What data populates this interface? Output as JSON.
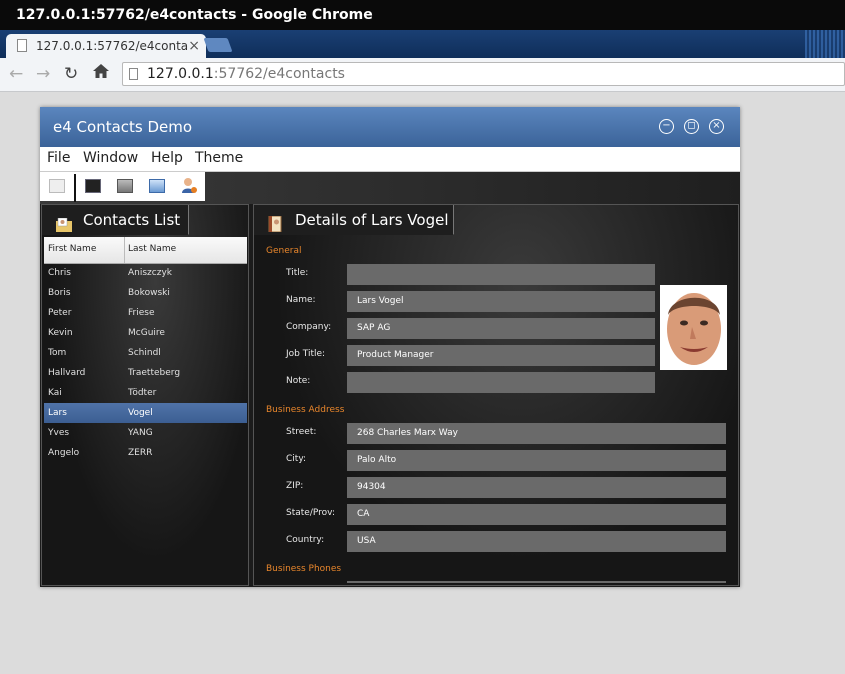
{
  "chrome": {
    "window_title": "127.0.0.1:57762/e4contacts - Google Chrome",
    "tab_title": "127.0.0.1:57762/e4conta",
    "tab_close": "×",
    "url_host": "127.0.0.1",
    "url_rest": ":57762/e4contacts"
  },
  "app": {
    "title": "e4 Contacts Demo",
    "window_buttons": {
      "minimize": "−",
      "maximize": "◻",
      "close": "×"
    },
    "menu": [
      "File",
      "Window",
      "Help",
      "Theme"
    ],
    "toolbar_icons": [
      "save-icon",
      "dark-theme-icon",
      "gray-theme-icon",
      "blue-theme-icon",
      "user-icon"
    ]
  },
  "contacts_panel": {
    "tab_label": "Contacts List",
    "columns": [
      "First Name",
      "Last Name"
    ],
    "rows": [
      {
        "first": "Chris",
        "last": "Aniszczyk"
      },
      {
        "first": "Boris",
        "last": "Bokowski"
      },
      {
        "first": "Peter",
        "last": "Friese"
      },
      {
        "first": "Kevin",
        "last": "McGuire"
      },
      {
        "first": "Tom",
        "last": "Schindl"
      },
      {
        "first": "Hallvard",
        "last": "Traetteberg"
      },
      {
        "first": "Kai",
        "last": "Tödter"
      },
      {
        "first": "Lars",
        "last": "Vogel"
      },
      {
        "first": "Yves",
        "last": "YANG"
      },
      {
        "first": "Angelo",
        "last": "ZERR"
      }
    ],
    "selected": "Lars"
  },
  "details_panel": {
    "tab_label": "Details of Lars Vogel",
    "general": {
      "title": "General",
      "fields": [
        {
          "label": "Title:",
          "value": ""
        },
        {
          "label": "Name:",
          "value": "Lars Vogel"
        },
        {
          "label": "Company:",
          "value": "SAP AG"
        },
        {
          "label": "Job Title:",
          "value": "Product Manager"
        },
        {
          "label": "Note:",
          "value": ""
        }
      ]
    },
    "business_address": {
      "title": "Business Address",
      "fields": [
        {
          "label": "Street:",
          "value": "268 Charles Marx Way"
        },
        {
          "label": "City:",
          "value": "Palo Alto"
        },
        {
          "label": "ZIP:",
          "value": "94304"
        },
        {
          "label": "State/Prov:",
          "value": "CA"
        },
        {
          "label": "Country:",
          "value": "USA"
        }
      ]
    },
    "business_phones_title": "Business Phones"
  },
  "colors": {
    "accent_section": "#e8862c",
    "selection": "#4a6ea3",
    "titlebar": "#4a74ad"
  }
}
